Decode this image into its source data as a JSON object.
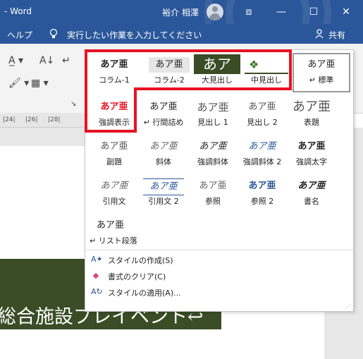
{
  "app": {
    "title": "- Word",
    "user": "裕介 相澤",
    "share": "共有"
  },
  "window_buttons": {
    "ribbon_options": "⧈",
    "minimize": "—",
    "maximize": "☐",
    "close": "✕"
  },
  "menubar": {
    "help": "ヘルプ",
    "tell_me": "実行したい作業を入力してください",
    "lightbulb_icon": "bulb",
    "share_icon": "person"
  },
  "ruler": {
    "ticks": [
      "|24|",
      "|26|",
      "|28|"
    ]
  },
  "document": {
    "banner_text": "総合施設プレイベント↩"
  },
  "styles": [
    {
      "preview": "あア亜",
      "name": "コラム-1"
    },
    {
      "preview": "あア亜",
      "name": "コラム-2"
    },
    {
      "preview": "あア",
      "name": "大見出し"
    },
    {
      "preview": "❖",
      "name": "中見出し"
    },
    {
      "preview": "あア亜",
      "name": "↵ 標準"
    },
    {
      "preview": "あア亜",
      "name": "強調表示"
    },
    {
      "preview": "あア亜",
      "name": "↵ 行間詰め"
    },
    {
      "preview": "あア亜",
      "name": "見出し 1"
    },
    {
      "preview": "あア亜",
      "name": "見出し 2"
    },
    {
      "preview": "あア亜",
      "name": "表題"
    },
    {
      "preview": "あア亜",
      "name": "副題"
    },
    {
      "preview": "あア亜",
      "name": "斜体"
    },
    {
      "preview": "あア亜",
      "name": "強調斜体"
    },
    {
      "preview": "あア亜",
      "name": "強調斜体 2"
    },
    {
      "preview": "あア亜",
      "name": "強調太字"
    },
    {
      "preview": "あア亜",
      "name": "引用文"
    },
    {
      "preview": "あア亜",
      "name": "引用文 2"
    },
    {
      "preview": "あア亜",
      "name": "参照"
    },
    {
      "preview": "あア亜",
      "name": "参照 2"
    },
    {
      "preview": "あア亜",
      "name": "書名"
    },
    {
      "preview": "あア亜",
      "name": "↵ リスト段落"
    }
  ],
  "commands": [
    {
      "label": "スタイルの作成(S)",
      "icon": "create-style-icon"
    },
    {
      "label": "書式のクリア(C)",
      "icon": "clear-format-icon"
    },
    {
      "label": "スタイルの適用(A)...",
      "icon": "apply-style-icon"
    }
  ],
  "colors": {
    "ribbon_blue": "#2b579a",
    "highlight_red": "#e81123",
    "heading_green": "#3a4d26"
  }
}
